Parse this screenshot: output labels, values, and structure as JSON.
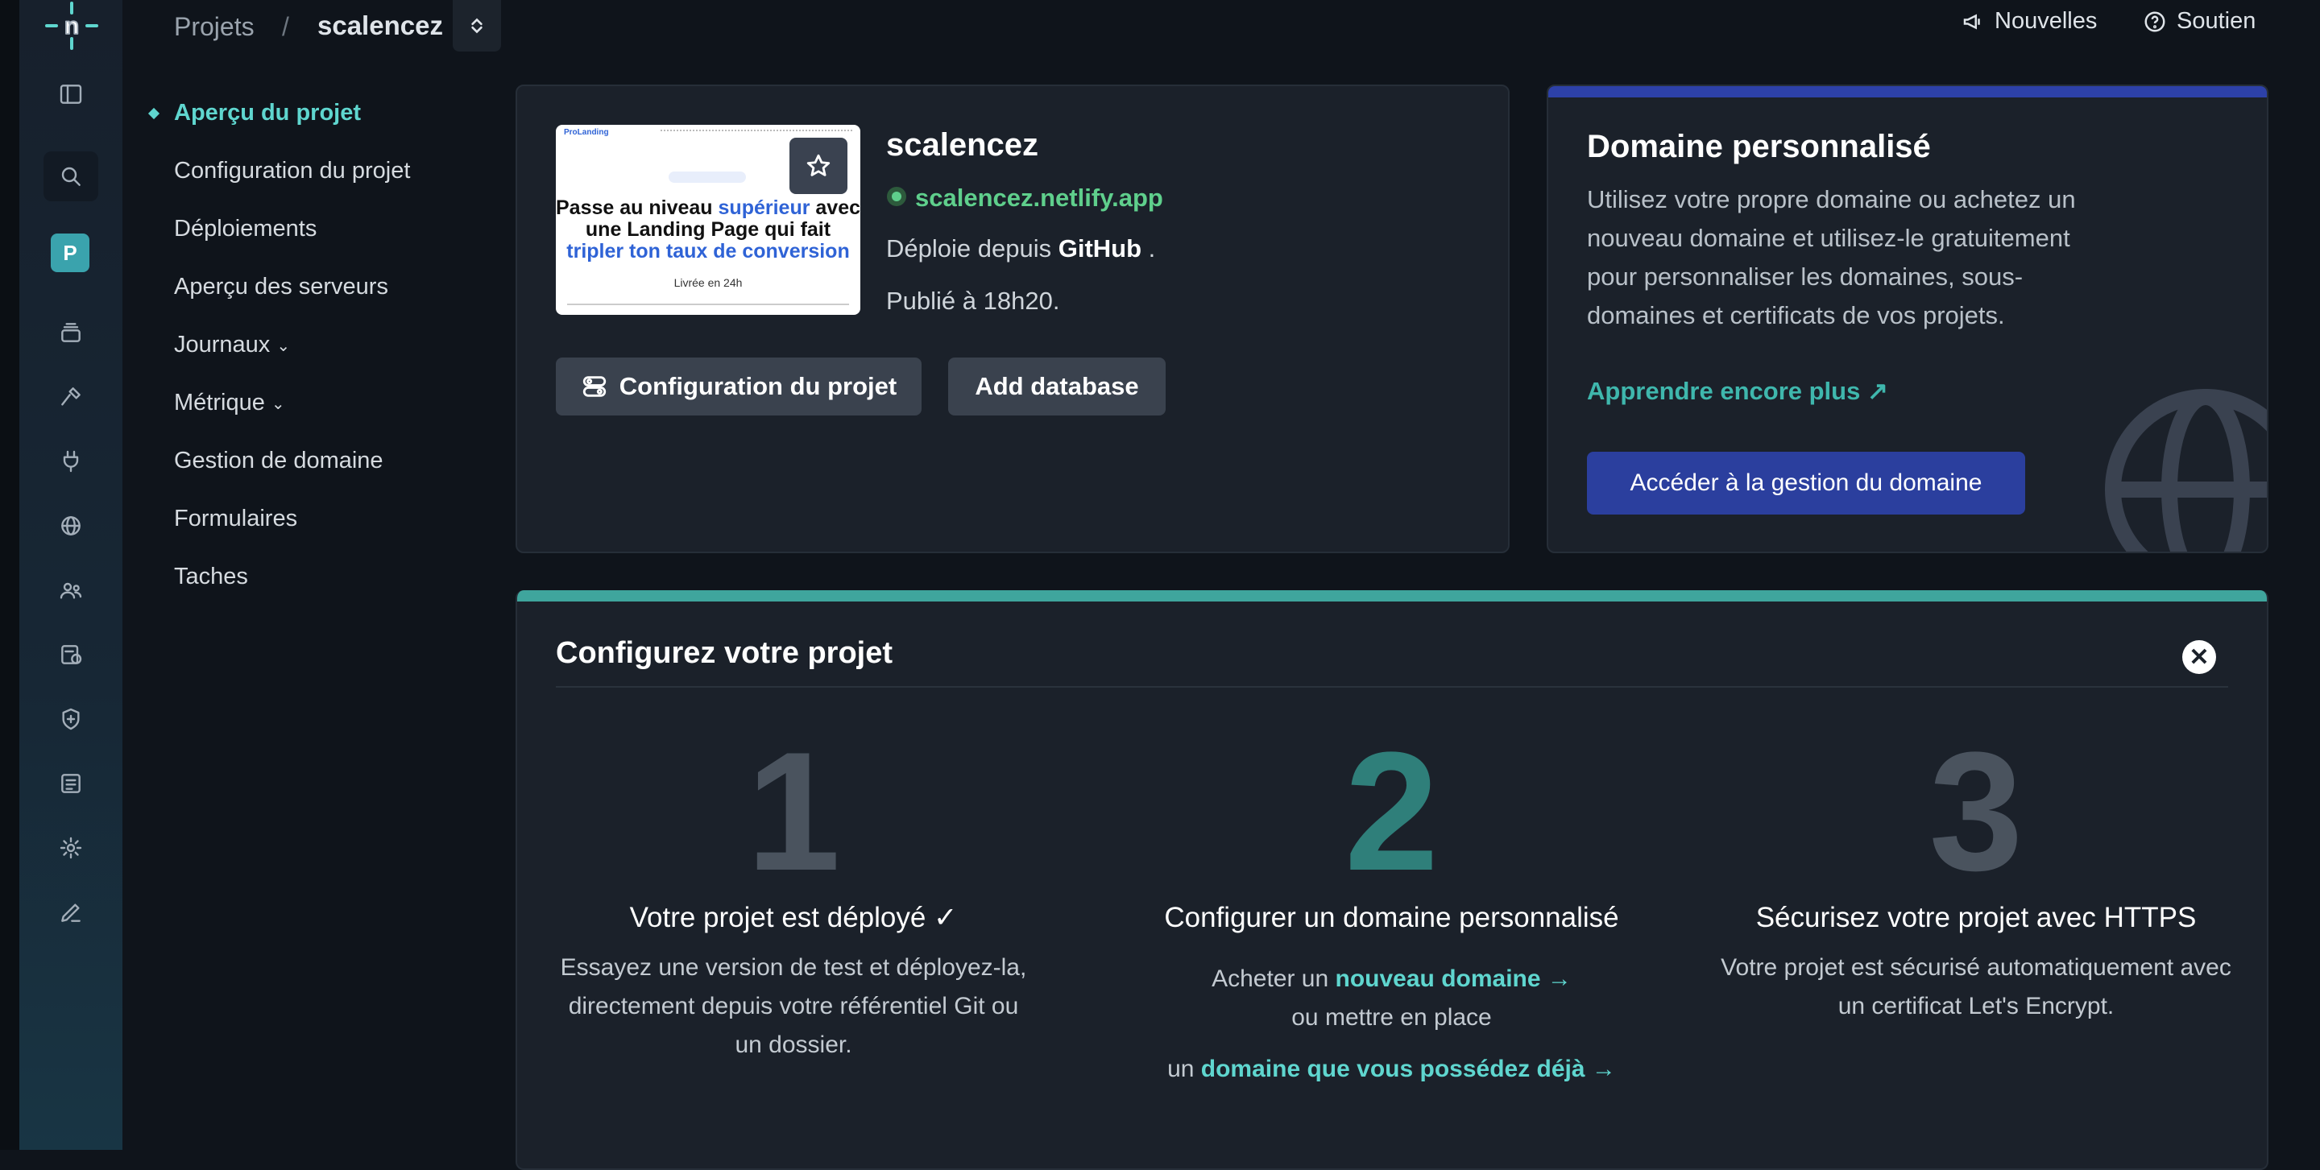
{
  "breadcrumb": {
    "projects": "Projets",
    "separator": "/",
    "current": "scalencez"
  },
  "top_actions": {
    "news": "Nouvelles",
    "support": "Soutien"
  },
  "rail": {
    "avatar_letter": "P"
  },
  "nav": {
    "overview": "Aperçu du projet",
    "config": "Configuration du projet",
    "deploys": "Déploiements",
    "servers": "Aperçu des serveurs",
    "logs": "Journaux",
    "metrics": "Métrique",
    "domain": "Gestion de domaine",
    "forms": "Formulaires",
    "tasks": "Taches"
  },
  "project": {
    "name": "scalencez",
    "url": "scalencez.netlify.app",
    "deploy_prefix": "Déploie depuis",
    "deploy_source": "GitHub",
    "deploy_suffix": ".",
    "published": "Publié à 18h20.",
    "config_button": "Configuration du projet",
    "add_db_button": "Add database",
    "thumbnail": {
      "brand": "ProLanding",
      "headline_1": "Passe au niveau ",
      "headline_blue_1": "supérieur",
      "headline_2": " avec une Landing Page qui fait ",
      "headline_blue_2": "tripler ton taux de conversion",
      "sub": "Livrée en 24h"
    }
  },
  "domain_card": {
    "title": "Domaine personnalisé",
    "text": "Utilisez votre propre domaine ou achetez un nouveau domaine et utilisez-le gratuitement pour personnaliser les domaines, sous-domaines et certificats de vos projets.",
    "learn_more": "Apprendre encore plus ↗",
    "button": "Accéder à la gestion du domaine"
  },
  "setup": {
    "title": "Configurez votre projet",
    "close_symbol": "✕",
    "steps": [
      {
        "number": "1",
        "title": "Votre projet est déployé ✓",
        "text": "Essayez une version de test et déployez-la, directement depuis votre référentiel Git ou un dossier."
      },
      {
        "number": "2",
        "title": "Configurer un domaine personnalisé",
        "pre1": "Acheter un",
        "link1": "nouveau domaine →",
        "mid": "ou mettre en place",
        "pre2": "un",
        "link2": "domaine que vous possédez déjà →"
      },
      {
        "number": "3",
        "title": "Sécurisez votre projet avec HTTPS",
        "text": "Votre projet est sécurisé automatiquement avec un certificat Let's Encrypt."
      }
    ]
  },
  "colors": {
    "accent": "#5fd6cf",
    "step2": "#2f7f7a",
    "step_muted": "#4a535e",
    "domain_bar": "#2d41a8",
    "setup_bar": "#3fa59d"
  }
}
